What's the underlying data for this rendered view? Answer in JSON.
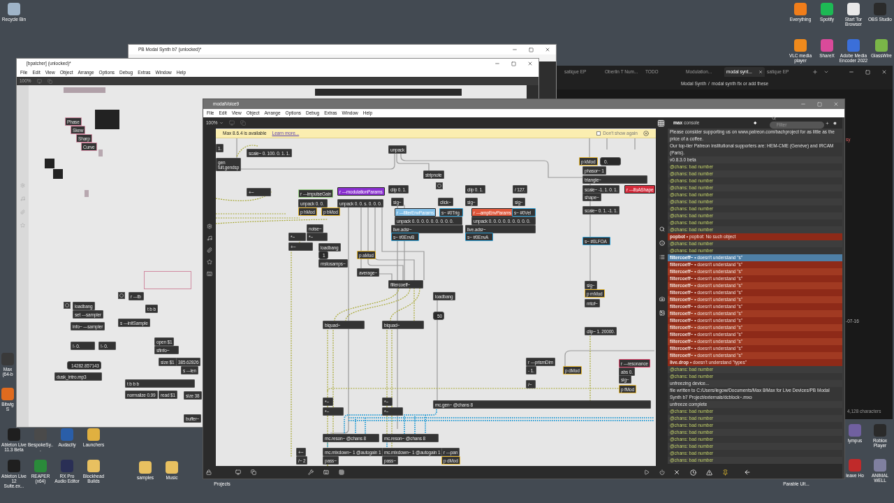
{
  "desktop_icons": [
    {
      "label": "Recycle Bin"
    },
    {
      "label": "Everything"
    },
    {
      "label": "Spotify"
    },
    {
      "label": "Start Tor Browser"
    },
    {
      "label": "OBS Studio"
    },
    {
      "label": "VLC media player"
    },
    {
      "label": "ShareX"
    },
    {
      "label": "Adobe Media Encoder 2022"
    },
    {
      "label": "GlassWire"
    },
    {
      "label": "Max (64-b"
    },
    {
      "label": "Bitwig S"
    },
    {
      "label": "Ableton Live 11.3 Beta"
    },
    {
      "label": "BespokeSy..."
    },
    {
      "label": "Audacity"
    },
    {
      "label": "Launchers"
    },
    {
      "label": "Ableton Live 12 Suite.ex..."
    },
    {
      "label": "REAPER (x64)"
    },
    {
      "label": "RX Pro Audio Editor"
    },
    {
      "label": "Blockhead Builds"
    },
    {
      "label": "samples"
    },
    {
      "label": "Music"
    },
    {
      "label": "Projects"
    },
    {
      "label": "Parable Ult..."
    },
    {
      "label": "lympus"
    },
    {
      "label": "Roblox Player"
    },
    {
      "label": "leave Ho"
    },
    {
      "label": "ANIMAL WELL"
    }
  ],
  "synth_window": {
    "title": "PB Modal Synth b7 (unlocked)*"
  },
  "bpatcher_window": {
    "title": "[bpatcher] (unlocked)*",
    "menu": [
      "File",
      "Edit",
      "View",
      "Object",
      "Arrange",
      "Options",
      "Debug",
      "Extras",
      "Window",
      "Help"
    ],
    "zoom": "100%",
    "objects": [
      {
        "kind": "outlined",
        "text": "Phase",
        "color": "#d08aa0"
      },
      {
        "kind": "outlined",
        "text": "Skew",
        "color": "#d08aa0"
      },
      {
        "kind": "outlined",
        "text": "Sharp",
        "color": "#d08aa0"
      },
      {
        "kind": "outlined",
        "text": "Curve",
        "color": "#d08aa0"
      },
      {
        "kind": "button"
      },
      {
        "kind": "object",
        "text": "loadbang"
      },
      {
        "kind": "object",
        "text": "set ---sampler"
      },
      {
        "kind": "button"
      },
      {
        "kind": "object",
        "text": "r ---tb"
      },
      {
        "kind": "object",
        "text": "t b b"
      },
      {
        "kind": "object",
        "text": "info~ ---sampler"
      },
      {
        "kind": "object",
        "text": "s ---initSample"
      },
      {
        "kind": "object",
        "text": "!- 0."
      },
      {
        "kind": "object",
        "text": "!- 0."
      },
      {
        "kind": "object",
        "text": "open $1"
      },
      {
        "kind": "object",
        "text": "sfinfo~"
      },
      {
        "kind": "object",
        "text": "size $1"
      },
      {
        "kind": "object",
        "text": "385.62826"
      },
      {
        "kind": "object",
        "text": "s ---len"
      },
      {
        "kind": "number",
        "text": "14282.857143"
      },
      {
        "kind": "object",
        "text": "dusk_intro.mp3"
      },
      {
        "kind": "object",
        "text": "t b b b"
      },
      {
        "kind": "object",
        "text": "normalize 0.99"
      },
      {
        "kind": "object",
        "text": "read $1"
      },
      {
        "kind": "object",
        "text": "size 38"
      },
      {
        "kind": "object",
        "text": "buffer~"
      }
    ]
  },
  "browser_window": {
    "tabs": [
      {
        "label": "satique EP",
        "selected": false
      },
      {
        "label": "Oberlin T Num...",
        "selected": false
      },
      {
        "label": "TODO",
        "selected": false
      },
      {
        "label": "Modulation...",
        "selected": false
      },
      {
        "label": "modal synt...",
        "selected": true
      },
      {
        "label": "satique EP",
        "selected": false
      }
    ],
    "breadcrumb": [
      "Modal Synth",
      "/",
      "modal synth fix or add these"
    ],
    "side_texts": [
      "sy",
      "-07-16"
    ],
    "status": "4,128 characters"
  },
  "main_window": {
    "title": "modalVoice9",
    "menu": [
      "File",
      "Edit",
      "View",
      "Object",
      "Arrange",
      "Options",
      "Debug",
      "Extras",
      "Window",
      "Help"
    ],
    "zoom": "100%",
    "notification": {
      "text": "Max 8.6.4 is available",
      "link": "Learn more...",
      "checkbox_label": "Don't show again",
      "checked": false
    },
    "objects": [
      {
        "kind": "object",
        "text": "1."
      },
      {
        "kind": "object",
        "text": "scale~ 0. 100. 0. 1. 1."
      },
      {
        "kind": "object",
        "text": "gen\ntult.gendsp"
      },
      {
        "kind": "object",
        "text": "unpack"
      },
      {
        "kind": "object",
        "text": "stripnote"
      },
      {
        "kind": "outlined",
        "text": "p kMod",
        "color": "#e8b830"
      },
      {
        "kind": "number",
        "text": "0."
      },
      {
        "kind": "object",
        "text": "phasor~ 1"
      },
      {
        "kind": "object",
        "text": "triangle~"
      },
      {
        "kind": "object",
        "text": "scale~ -1. 1. 0. 1."
      },
      {
        "kind": "filled",
        "text": "r ---lfoAShape",
        "color": "#d42a3a"
      },
      {
        "kind": "object",
        "text": "shape~"
      },
      {
        "kind": "object",
        "text": "scale~ 0. 1. -1. 1."
      },
      {
        "kind": "outlined",
        "text": "s~ #0LFOA",
        "color": "#2c9fd6"
      },
      {
        "kind": "object",
        "text": "clip 0. 1."
      },
      {
        "kind": "button"
      },
      {
        "kind": "object",
        "text": "clip 0. 1."
      },
      {
        "kind": "object",
        "text": "/ 127."
      },
      {
        "kind": "object",
        "text": "+~"
      },
      {
        "kind": "outlined",
        "text": "r ---impulseGain",
        "color": "#9fd88a"
      },
      {
        "kind": "filled",
        "text": "r ---modulationParams",
        "color": "#8a2fd0"
      },
      {
        "kind": "object",
        "text": "unpack 0. 0."
      },
      {
        "kind": "object",
        "text": "unpack 0. 0. s. 0. 0. 0."
      },
      {
        "kind": "object",
        "text": "sig~"
      },
      {
        "kind": "object",
        "text": "click~"
      },
      {
        "kind": "object",
        "text": "sig~"
      },
      {
        "kind": "object",
        "text": "sig~"
      },
      {
        "kind": "outlined",
        "text": "p hMod",
        "color": "#e8b830"
      },
      {
        "kind": "outlined",
        "text": "p bMod",
        "color": "#e8b830"
      },
      {
        "kind": "filled",
        "text": "r ---filterEnvParams",
        "color": "#7fbde6"
      },
      {
        "kind": "outlined",
        "text": "s~ #0Trig",
        "color": "#2c9fd6"
      },
      {
        "kind": "filled",
        "text": "r ---ampEnvParams",
        "color": "#e0563a"
      },
      {
        "kind": "outlined",
        "text": "s~ #0Vel",
        "color": "#2c9fd6"
      },
      {
        "kind": "object",
        "text": "unpack 0. 0. 0. 0. 0. 0. 0. 0. 0."
      },
      {
        "kind": "object",
        "text": "unpack 0. 0. 0. 0. 0. 0. 0. 0. 0."
      },
      {
        "kind": "object",
        "text": "noise~"
      },
      {
        "kind": "object",
        "text": "live.adsr~"
      },
      {
        "kind": "object",
        "text": "live.adsr~"
      },
      {
        "kind": "object",
        "text": "*~"
      },
      {
        "kind": "object",
        "text": "*~"
      },
      {
        "kind": "outlined",
        "text": "s~ #0EnvB",
        "color": "#2c9fd6"
      },
      {
        "kind": "outlined",
        "text": "s~ #0EnvA",
        "color": "#2c9fd6"
      },
      {
        "kind": "object",
        "text": "+~"
      },
      {
        "kind": "object",
        "text": "loadbang"
      },
      {
        "kind": "number",
        "text": "1"
      },
      {
        "kind": "outlined",
        "text": "p aMod",
        "color": "#e8b830"
      },
      {
        "kind": "object",
        "text": "mstosamps~"
      },
      {
        "kind": "object",
        "text": "average~"
      },
      {
        "kind": "object",
        "text": "filtercoeff~"
      },
      {
        "kind": "object",
        "text": "loadbang"
      },
      {
        "kind": "number",
        "text": "50"
      },
      {
        "kind": "object",
        "text": "biquad~"
      },
      {
        "kind": "object",
        "text": "biquad~"
      },
      {
        "kind": "object",
        "text": "sig~"
      },
      {
        "kind": "outlined",
        "text": "p mMod",
        "color": "#e8b830"
      },
      {
        "kind": "object",
        "text": "mtof~"
      },
      {
        "kind": "object",
        "text": "clip~ 1. 20000."
      },
      {
        "kind": "object",
        "text": "r ---prismDim"
      },
      {
        "kind": "object",
        "text": "- 1."
      },
      {
        "kind": "outlined",
        "text": "p dMod",
        "color": "#e8b830"
      },
      {
        "kind": "object",
        "text": "/~"
      },
      {
        "kind": "outlined",
        "text": "r ---resonance",
        "color": "#e0406a"
      },
      {
        "kind": "object",
        "text": "abs 0."
      },
      {
        "kind": "object",
        "text": "sig~"
      },
      {
        "kind": "outlined",
        "text": "p fMod",
        "color": "#e8b830"
      },
      {
        "kind": "object",
        "text": "*~"
      },
      {
        "kind": "object",
        "text": "*~"
      },
      {
        "kind": "object",
        "text": "mc.gen~ @chans 8"
      },
      {
        "kind": "object",
        "text": "*~"
      },
      {
        "kind": "object",
        "text": "*~"
      },
      {
        "kind": "object",
        "text": "mc.reson~ @chans 8"
      },
      {
        "kind": "object",
        "text": "mc.reson~ @chans 8"
      },
      {
        "kind": "object",
        "text": "+~"
      },
      {
        "kind": "object",
        "text": "mc.mixdown~ 1 @autogain 1"
      },
      {
        "kind": "object",
        "text": "mc.mixdown~ 1 @autogain 1"
      },
      {
        "kind": "object",
        "text": "r ---pan"
      },
      {
        "kind": "object",
        "text": "/~ 2"
      },
      {
        "kind": "object",
        "text": "pass~"
      },
      {
        "kind": "object",
        "text": "pass~"
      },
      {
        "kind": "outlined",
        "text": "p dMod",
        "color": "#e8b830"
      }
    ],
    "console": {
      "title_bold": "max",
      "title": "console",
      "filter_placeholder": "Filter",
      "lines": [
        {
          "kind": "info",
          "selected": false,
          "text": "Please consider supporting us on www.patreon.com/bachproject for as little as the price of a coffee."
        },
        {
          "kind": "info",
          "selected": false,
          "text": "Our top-tier Patreon institutional supporters are: HEM-CME (Genève) and IRCAM (Paris)."
        },
        {
          "kind": "info",
          "selected": false,
          "text": "v0.8.3.0 beta"
        },
        {
          "kind": "warn",
          "selected": false,
          "text": "@chans: bad number"
        },
        {
          "kind": "warn",
          "selected": false,
          "text": "@chans: bad number"
        },
        {
          "kind": "warn",
          "selected": false,
          "text": "@chans: bad number"
        },
        {
          "kind": "warn",
          "selected": false,
          "text": "@chans: bad number"
        },
        {
          "kind": "warn",
          "selected": false,
          "text": "@chans: bad number"
        },
        {
          "kind": "warn",
          "selected": false,
          "text": "@chans: bad number"
        },
        {
          "kind": "warn",
          "selected": false,
          "text": "@chans: bad number"
        },
        {
          "kind": "warn",
          "selected": false,
          "text": "@chans: bad number"
        },
        {
          "kind": "warn",
          "selected": false,
          "text": "@chans: bad number"
        },
        {
          "kind": "warn",
          "selected": false,
          "text": "@chans: bad number"
        },
        {
          "kind": "error",
          "selected": false,
          "text": "**popbot** • popbot: No such object"
        },
        {
          "kind": "warn",
          "selected": false,
          "text": "@chans: bad number"
        },
        {
          "kind": "warn",
          "selected": false,
          "text": "@chans: bad number"
        },
        {
          "kind": "error",
          "selected": true,
          "text": "**filtercoeff~** • doesn't understand \"s\""
        },
        {
          "kind": "error",
          "selected": false,
          "text": "**filtercoeff~** • doesn't understand \"s\""
        },
        {
          "kind": "error",
          "selected": false,
          "text": "**filtercoeff~** • doesn't understand \"s\""
        },
        {
          "kind": "error",
          "selected": false,
          "text": "**filtercoeff~** • doesn't understand \"s\""
        },
        {
          "kind": "error",
          "selected": false,
          "text": "**filtercoeff~** • doesn't understand \"s\""
        },
        {
          "kind": "error",
          "selected": false,
          "text": "**filtercoeff~** • doesn't understand \"s\""
        },
        {
          "kind": "error",
          "selected": false,
          "text": "**filtercoeff~** • doesn't understand \"s\""
        },
        {
          "kind": "error",
          "selected": false,
          "text": "**filtercoeff~** • doesn't understand \"s\""
        },
        {
          "kind": "error",
          "selected": false,
          "text": "**filtercoeff~** • doesn't understand \"s\""
        },
        {
          "kind": "error",
          "selected": false,
          "text": "**filtercoeff~** • doesn't understand \"s\""
        },
        {
          "kind": "error",
          "selected": false,
          "text": "**filtercoeff~** • doesn't understand \"s\""
        },
        {
          "kind": "error",
          "selected": false,
          "text": "**filtercoeff~** • doesn't understand \"s\""
        },
        {
          "kind": "error",
          "selected": false,
          "text": "**filtercoeff~** • doesn't understand \"s\""
        },
        {
          "kind": "error",
          "selected": false,
          "text": "**filtercoeff~** • doesn't understand \"s\""
        },
        {
          "kind": "error",
          "selected": false,
          "text": "**filtercoeff~** • doesn't understand \"s\""
        },
        {
          "kind": "error",
          "selected": false,
          "text": "**live.drop** • doesn't understand \"types\""
        },
        {
          "kind": "warn",
          "selected": false,
          "text": "@chans: bad number"
        },
        {
          "kind": "warn",
          "selected": false,
          "text": "@chans: bad number"
        },
        {
          "kind": "info",
          "selected": false,
          "text": "unfreezing device..."
        },
        {
          "kind": "info",
          "selected": false,
          "text": "file written to C:/Users/legow/Documents/Max 8/Max for Live Devices/PB Modal Synth b7 Project/externals/dcblock~.mxo"
        },
        {
          "kind": "info",
          "selected": false,
          "text": "unfreeze complete"
        },
        {
          "kind": "warn",
          "selected": false,
          "text": "@chans: bad number"
        },
        {
          "kind": "warn",
          "selected": false,
          "text": "@chans: bad number"
        },
        {
          "kind": "warn",
          "selected": false,
          "text": "@chans: bad number"
        },
        {
          "kind": "warn",
          "selected": false,
          "text": "@chans: bad number"
        },
        {
          "kind": "warn",
          "selected": false,
          "text": "@chans: bad number"
        },
        {
          "kind": "warn",
          "selected": false,
          "text": "@chans: bad number"
        },
        {
          "kind": "warn",
          "selected": false,
          "text": "@chans: bad number"
        },
        {
          "kind": "warn",
          "selected": false,
          "text": "@chans: bad number"
        }
      ]
    }
  }
}
